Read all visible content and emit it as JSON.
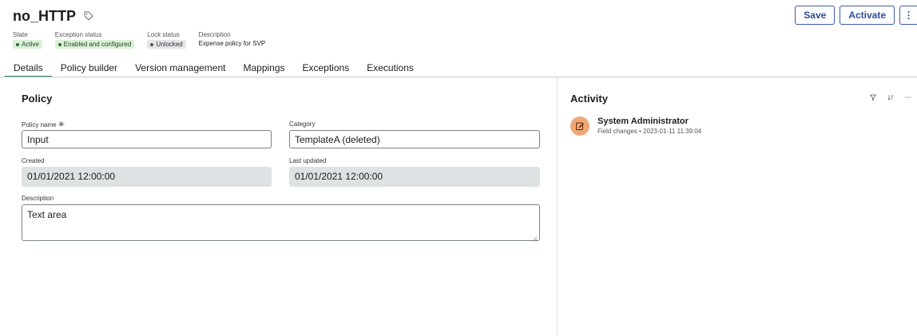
{
  "record": {
    "title": "no_HTTP",
    "meta": [
      {
        "label": "State",
        "value": "Active",
        "style": "green"
      },
      {
        "label": "Exception status",
        "value": "Enabled and configured",
        "style": "green"
      },
      {
        "label": "Lock status",
        "value": "Unlocked",
        "style": "gray"
      }
    ],
    "description_label": "Description",
    "description_value": "Expense policy for SVP"
  },
  "actions": {
    "save_label": "Save",
    "activate_label": "Activate",
    "more_label": "⋮"
  },
  "tabs": [
    {
      "label": "Details",
      "active": true
    },
    {
      "label": "Policy builder"
    },
    {
      "label": "Version management"
    },
    {
      "label": "Mappings"
    },
    {
      "label": "Exceptions"
    },
    {
      "label": "Executions"
    }
  ],
  "policy": {
    "section_title": "Policy",
    "name_label": "Policy name",
    "name_required_mark": "✳",
    "name_value": "Input",
    "category_label": "Category",
    "category_value": "TemplateA (deleted)",
    "created_label": "Created",
    "created_value": "01/01/2021 12:00:00",
    "updated_label": "Last updated",
    "updated_value": "01/01/2021 12:00:00",
    "description_label": "Description",
    "description_value": "Text area"
  },
  "activity": {
    "title": "Activity",
    "tools": {
      "filter": "filter-icon",
      "sort": "sort-icon",
      "more": "more-icon"
    },
    "entries": [
      {
        "name": "System Administrator",
        "detail": "Field changes • 2023-01-11 11:39:04"
      }
    ]
  },
  "colors": {
    "accent": "#2d4c9d",
    "active_tab": "#2e7c62",
    "badge_green": "#dbf0d9",
    "avatar": "#f0a876"
  }
}
